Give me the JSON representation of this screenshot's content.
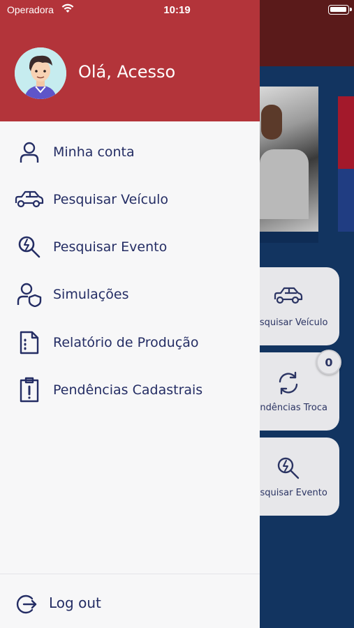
{
  "status_bar": {
    "carrier": "Operadora",
    "time": "10:19"
  },
  "drawer": {
    "greeting": "Olá, Acesso",
    "menu": [
      {
        "label": "Minha conta",
        "icon": "user-icon"
      },
      {
        "label": "Pesquisar Veículo",
        "icon": "car-icon"
      },
      {
        "label": "Pesquisar Evento",
        "icon": "search-event-icon"
      },
      {
        "label": "Simulações",
        "icon": "user-shield-icon"
      },
      {
        "label": "Relatório de Produção",
        "icon": "document-icon"
      },
      {
        "label": "Pendências Cadastrais",
        "icon": "clipboard-alert-icon"
      }
    ],
    "logout_label": "Log out"
  },
  "background": {
    "cards": [
      {
        "label": "Pesquisar Veículo",
        "icon": "car-icon"
      },
      {
        "label": "Pendências Troca",
        "icon": "refresh-icon"
      },
      {
        "label": "Pesquisar Evento",
        "icon": "search-event-icon"
      }
    ],
    "badge_count": "0"
  },
  "colors": {
    "header_red": "#b3343a",
    "navy_text": "#242d64",
    "bg_navy": "#123460"
  }
}
